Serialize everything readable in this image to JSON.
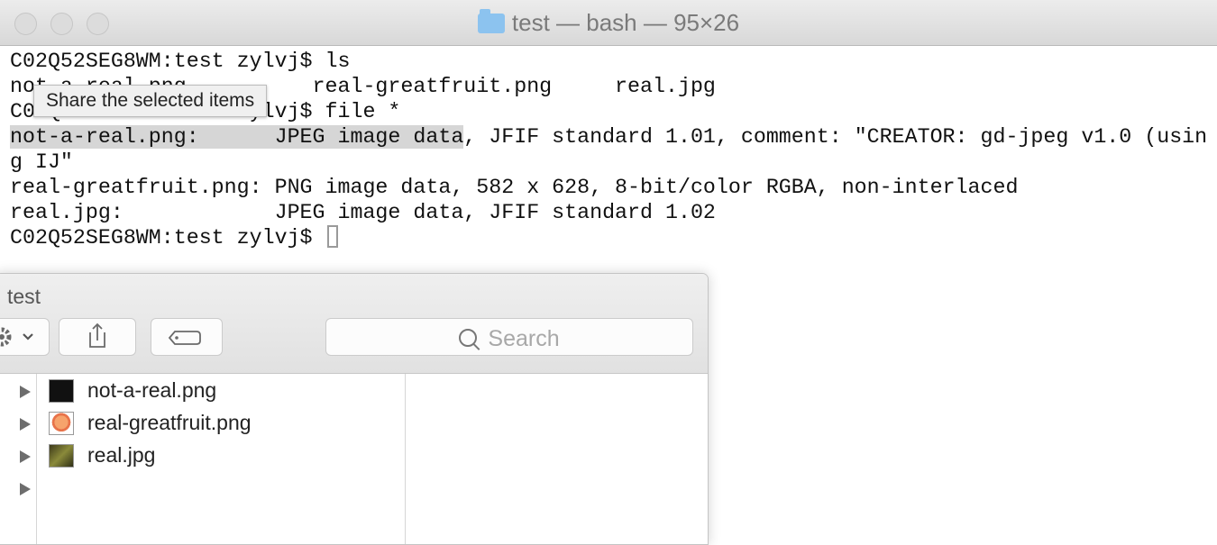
{
  "terminal": {
    "title": "test — bash — 95×26",
    "lines": [
      {
        "before": "",
        "sel": "",
        "after": "C02Q52SEG8WM:test zylvj$ ls"
      },
      {
        "before": "",
        "sel": "",
        "after": "not-a-real.png          real-greatfruit.png     real.jpg"
      },
      {
        "before": "",
        "sel": "",
        "after": "C02Q52SEG8WM:test zylvj$ file *"
      },
      {
        "before": "",
        "sel": "not-a-real.png:      JPEG image data",
        "after": ", JFIF standard 1.01, comment: \"CREATOR: gd-jpeg v1.0 (usin"
      },
      {
        "before": "",
        "sel": "",
        "after": "g IJ\""
      },
      {
        "before": "",
        "sel": "",
        "after": "real-greatfruit.png: PNG image data, 582 x 628, 8-bit/color RGBA, non-interlaced"
      },
      {
        "before": "",
        "sel": "",
        "after": "real.jpg:            JPEG image data, JFIF standard 1.02"
      }
    ],
    "prompt": "C02Q52SEG8WM:test zylvj$ "
  },
  "tooltip": {
    "text": "Share the selected items"
  },
  "finder": {
    "title": "test",
    "search_placeholder": "Search",
    "files": [
      {
        "name": "not-a-real.png",
        "thumb_color": "#111111"
      },
      {
        "name": "real-greatfruit.png",
        "thumb_color": "#e8734a"
      },
      {
        "name": "real.jpg",
        "thumb_color": "#6b6a2c"
      }
    ]
  },
  "icons": [
    "folder-icon",
    "gear-icon",
    "chevron-down-icon",
    "share-icon",
    "tag-icon",
    "search-icon",
    "disclosure-triangle-icon"
  ]
}
